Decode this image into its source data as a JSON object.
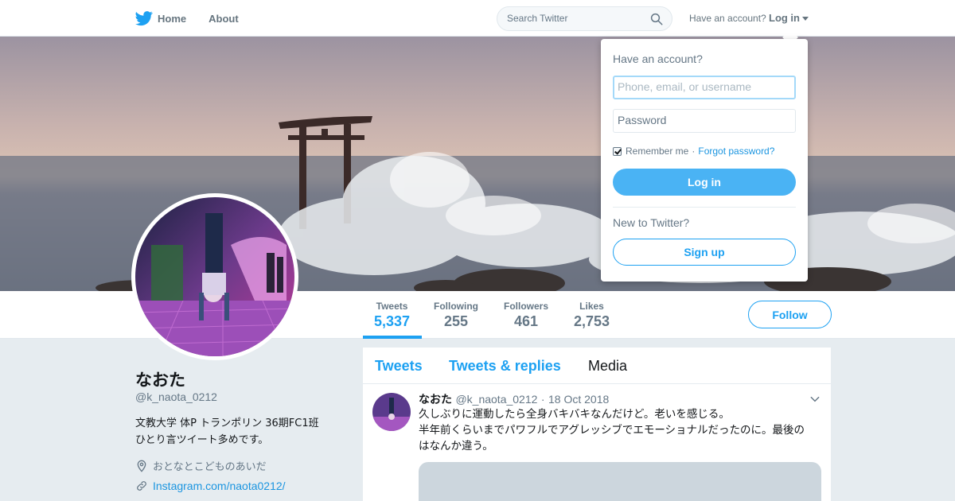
{
  "topbar": {
    "home_label": "Home",
    "about_label": "About",
    "search_placeholder": "Search Twitter",
    "have_account": "Have an account?",
    "login_label": "Log in"
  },
  "profile": {
    "name": "なおた",
    "handle": "@k_naota_0212",
    "bio_line1": "文教大学 体P トランポリン 36期FC1班",
    "bio_line2": "ひとり言ツイート多めです。",
    "location": "おとなとこどものあいだ",
    "link": "Instagram.com/naota0212/"
  },
  "stats": [
    {
      "label": "Tweets",
      "value": "5,337"
    },
    {
      "label": "Following",
      "value": "255"
    },
    {
      "label": "Followers",
      "value": "461"
    },
    {
      "label": "Likes",
      "value": "2,753"
    }
  ],
  "follow_label": "Follow",
  "timeline": {
    "tabs": [
      "Tweets",
      "Tweets & replies",
      "Media"
    ],
    "selected_tab": "Media",
    "tweet": {
      "name": "なおた",
      "handle": "@k_naota_0212",
      "date": "18 Oct 2018",
      "line1": "久しぶりに運動したら全身バキバキなんだけど。老いを感じる。",
      "line2": "半年前くらいまでパワフルでアグレッシブでエモーショナルだったのに。最後の",
      "line3": "はなんか違う。"
    }
  },
  "login_dropdown": {
    "title": "Have an account?",
    "username_placeholder": "Phone, email, or username",
    "password_placeholder": "Password",
    "remember_label": "Remember me",
    "separator": "·",
    "forgot_label": "Forgot password?",
    "login_button": "Log in",
    "new_label": "New to Twitter?",
    "signup_button": "Sign up"
  },
  "colors": {
    "accent": "#1da1f2",
    "login_button_bg": "#4ab3f4",
    "page_bg": "#e6ecf0",
    "muted_text": "#657786"
  },
  "icons": [
    "twitter-bird-icon",
    "search-icon",
    "caret-down-icon",
    "location-pin-icon",
    "link-icon",
    "chevron-down-icon"
  ]
}
